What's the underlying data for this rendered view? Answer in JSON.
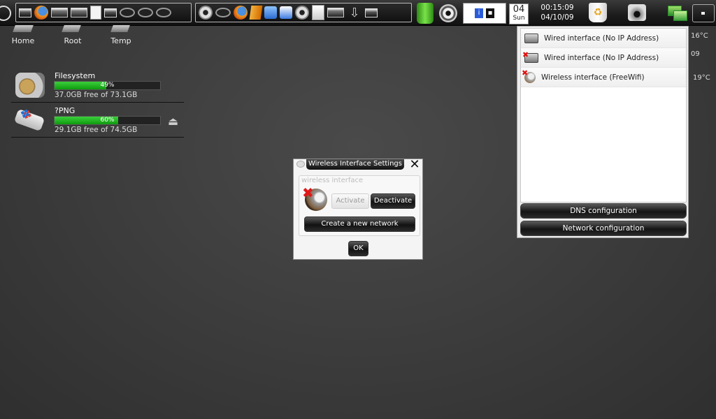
{
  "panel": {
    "calendar": {
      "day": "04",
      "weekday": "Sun"
    },
    "clock": {
      "time": "00:15:09",
      "date": "04/10/09"
    },
    "launchers": [
      "window-icon",
      "firefox-icon",
      "window-icon",
      "window-icon",
      "page-icon",
      "window-icon",
      "ring-icon",
      "ring-icon",
      "ring-icon"
    ],
    "apps": [
      "shell-icon",
      "ring-icon",
      "firefox-icon",
      "orange-app-icon",
      "blue-app-icon",
      "paint-icon",
      "film-icon",
      "document-icon",
      "window-icon",
      "download-arrow-icon",
      "window-icon"
    ],
    "tray": [
      "green-trash-icon",
      "disc-icon",
      "info-icon",
      "recycle-bin-icon",
      "camera-icon",
      "network-icon"
    ]
  },
  "desktop": {
    "icons": [
      {
        "label": "Home"
      },
      {
        "label": "Root"
      },
      {
        "label": "Temp"
      }
    ]
  },
  "drives": [
    {
      "name": "Filesystem",
      "percent": 49,
      "percent_label": "49%",
      "free": "37.0GB free of 73.1GB",
      "icon": "hard-drive-icon"
    },
    {
      "name": "?PNG",
      "percent": 60,
      "percent_label": "60%",
      "free": "29.1GB free of 74.5GB",
      "icon": "usb-drive-icon",
      "eject": "⏏"
    }
  ],
  "network_menu": {
    "items": [
      {
        "label": "Wired interface (No IP Address)",
        "icon": "wired-network-icon",
        "error": false
      },
      {
        "label": "Wired interface (No IP Address)",
        "icon": "wired-network-icon",
        "error": true
      },
      {
        "label": "Wireless interface (FreeWifi)",
        "icon": "wireless-dish-icon",
        "error": true
      }
    ],
    "dns_button": "DNS configuration",
    "network_button": "Network configuration"
  },
  "weather_partial": {
    "temp1": "16°C",
    "date_frag": "09",
    "temp2": "19°C"
  },
  "dialog": {
    "title": "Wireless Interface Settings",
    "group_label": "wireless interface",
    "activate": "Activate",
    "deactivate": "Deactivate",
    "create_network": "Create a new network",
    "ok": "OK"
  }
}
